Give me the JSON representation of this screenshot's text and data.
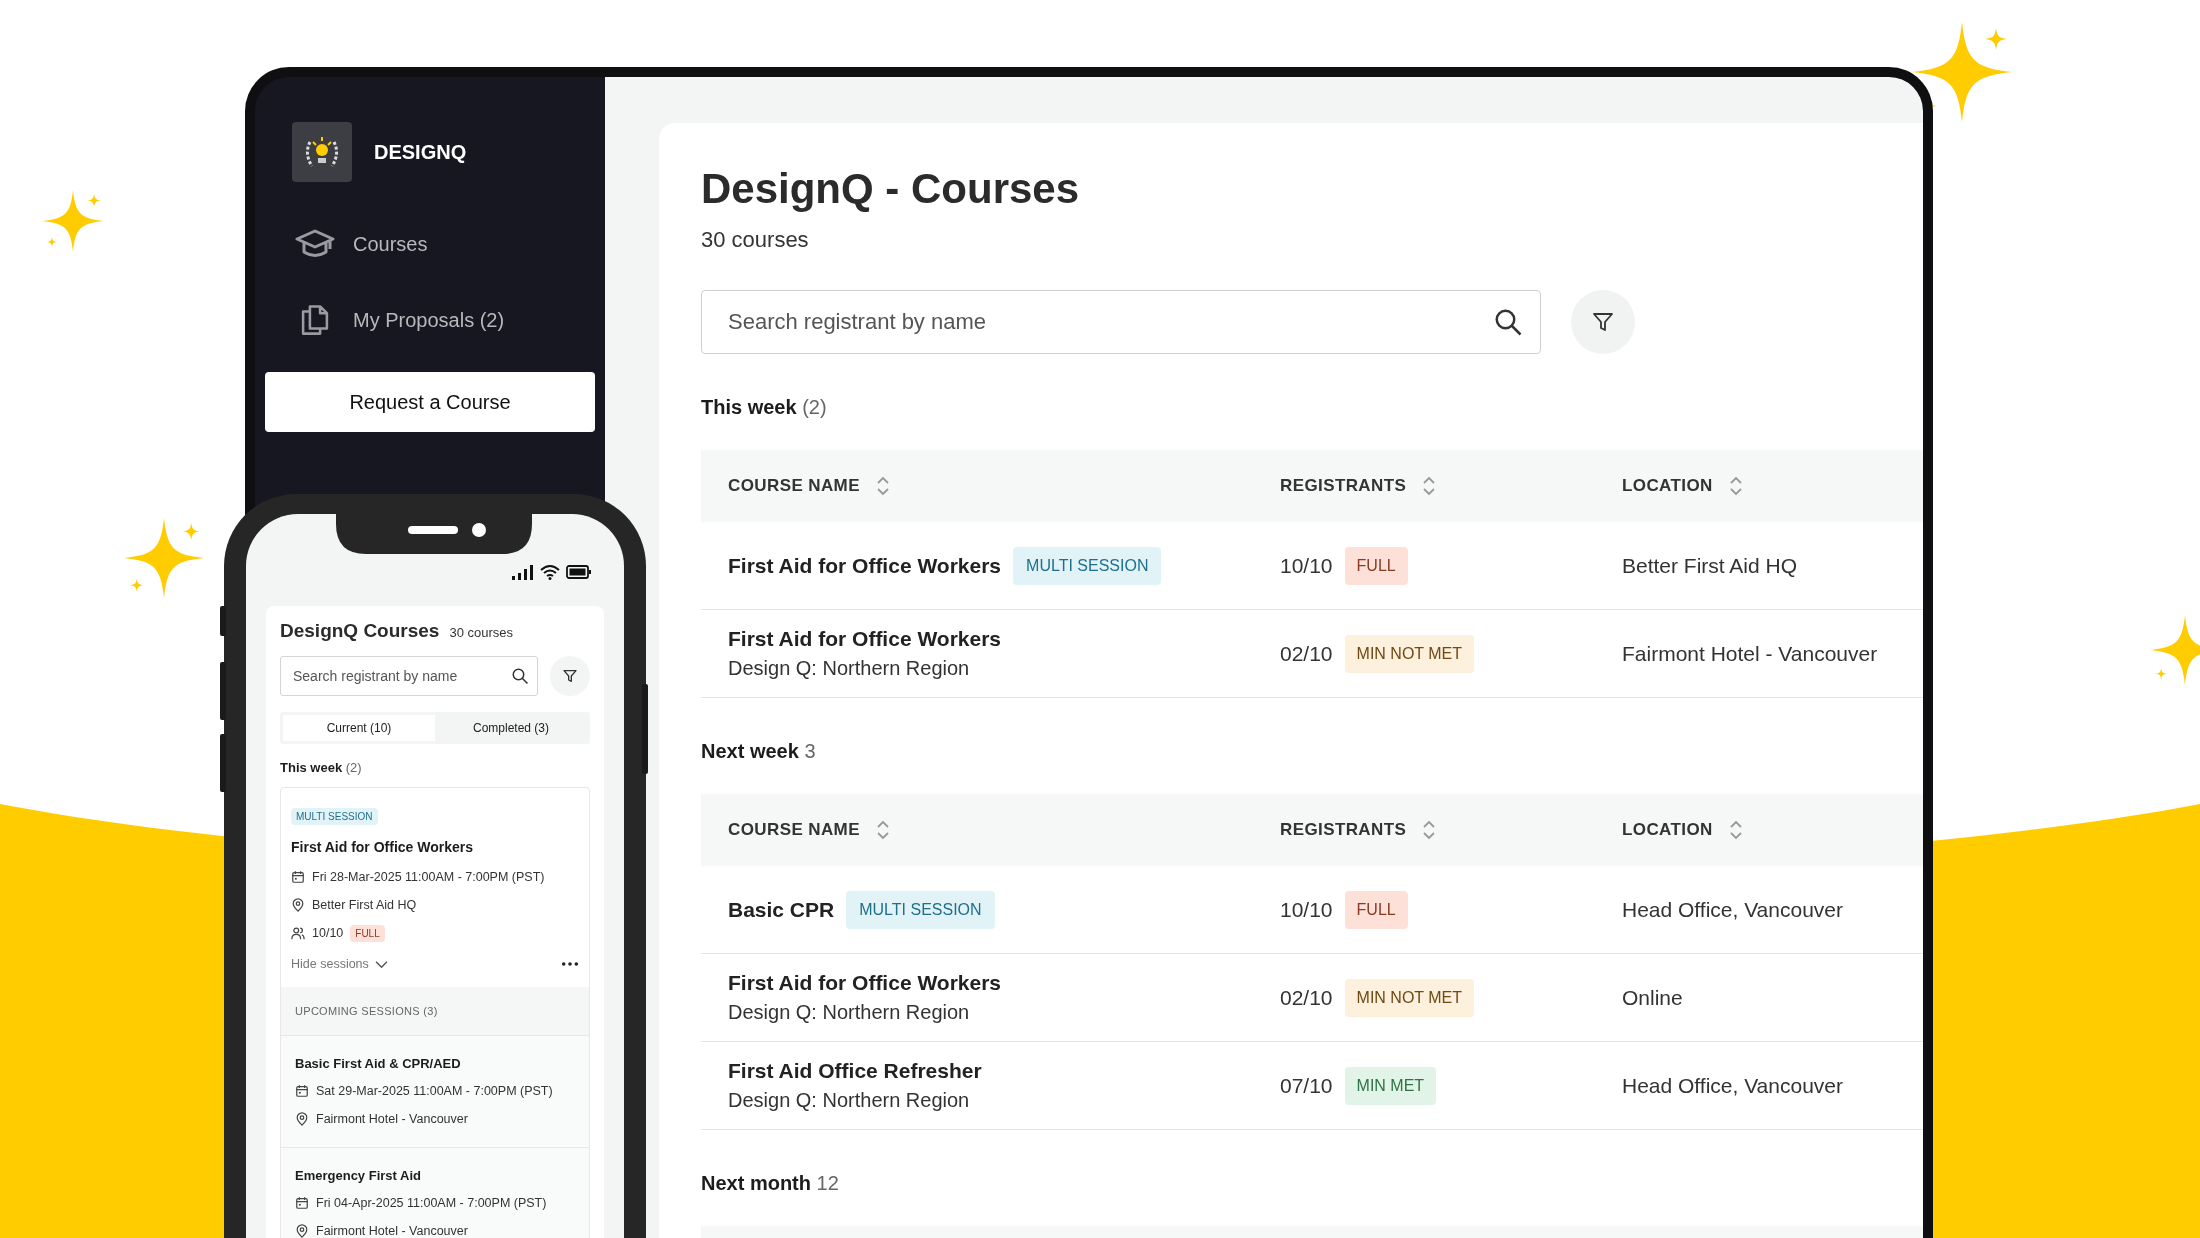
{
  "sidebar": {
    "brand": "DESIGNQ",
    "items": [
      {
        "label": "Courses",
        "selected": false
      },
      {
        "label": "My Proposals (2)",
        "selected": false
      }
    ],
    "button": "Request a Course"
  },
  "main": {
    "title": "DesignQ - Courses",
    "subtitle": "30 courses",
    "search": {
      "placeholder": "Search registrant by name"
    },
    "sections": [
      {
        "title": "This week",
        "count": "(2)",
        "columns": [
          "COURSE NAME",
          "REGISTRANTS",
          "LOCATION"
        ],
        "rows": [
          {
            "name": "First Aid for Office Workers",
            "tag": "MULTI SESSION",
            "registrants": "10/10",
            "status": {
              "label": "FULL",
              "kind": "full"
            },
            "location": "Better First Aid HQ"
          },
          {
            "name": "First Aid for Office Workers",
            "subtitle": "Design Q: Northern Region",
            "registrants": "02/10",
            "status": {
              "label": "MIN NOT MET",
              "kind": "min_not_met"
            },
            "location": "Fairmont Hotel - Vancouver"
          }
        ]
      },
      {
        "title": "Next week",
        "count": "3",
        "columns": [
          "COURSE NAME",
          "REGISTRANTS",
          "LOCATION"
        ],
        "rows": [
          {
            "name": "Basic CPR",
            "tag": "MULTI SESSION",
            "registrants": "10/10",
            "status": {
              "label": "FULL",
              "kind": "full"
            },
            "location": "Head Office, Vancouver"
          },
          {
            "name": "First Aid for Office Workers",
            "subtitle": "Design Q: Northern Region",
            "registrants": "02/10",
            "status": {
              "label": "MIN NOT MET",
              "kind": "min_not_met"
            },
            "location": "Online"
          },
          {
            "name": "First Aid Office Refresher",
            "subtitle": "Design Q: Northern Region",
            "registrants": "07/10",
            "status": {
              "label": "MIN MET",
              "kind": "min_met"
            },
            "location": "Head Office, Vancouver"
          }
        ]
      },
      {
        "title": "Next month",
        "count": "12"
      }
    ]
  },
  "phone": {
    "title": "DesignQ Courses",
    "count": "30 courses",
    "search": {
      "placeholder": "Search registrant by name"
    },
    "tabs": [
      {
        "label": "Current (10)",
        "selected": true
      },
      {
        "label": "Completed (3)",
        "selected": false
      }
    ],
    "section": {
      "title": "This week",
      "count": "(2)"
    },
    "card": {
      "tag": "MULTI SESSION",
      "name": "First Aid for Office Workers",
      "date": "Fri 28-Mar-2025 11:00AM - 7:00PM (PST)",
      "location": "Better First Aid HQ",
      "registrants": "10/10",
      "status": {
        "label": "FULL",
        "kind": "full"
      },
      "toggle": "Hide sessions",
      "sessions_title": "UPCOMING SESSIONS (3)",
      "sessions": [
        {
          "name": "Basic First Aid & CPR/AED",
          "date": "Sat 29-Mar-2025 11:00AM - 7:00PM (PST)",
          "location": "Fairmont Hotel - Vancouver"
        },
        {
          "name": "Emergency First Aid",
          "date": "Fri 04-Apr-2025 11:00AM - 7:00PM (PST)",
          "location": "Fairmont Hotel - Vancouver"
        }
      ]
    }
  }
}
